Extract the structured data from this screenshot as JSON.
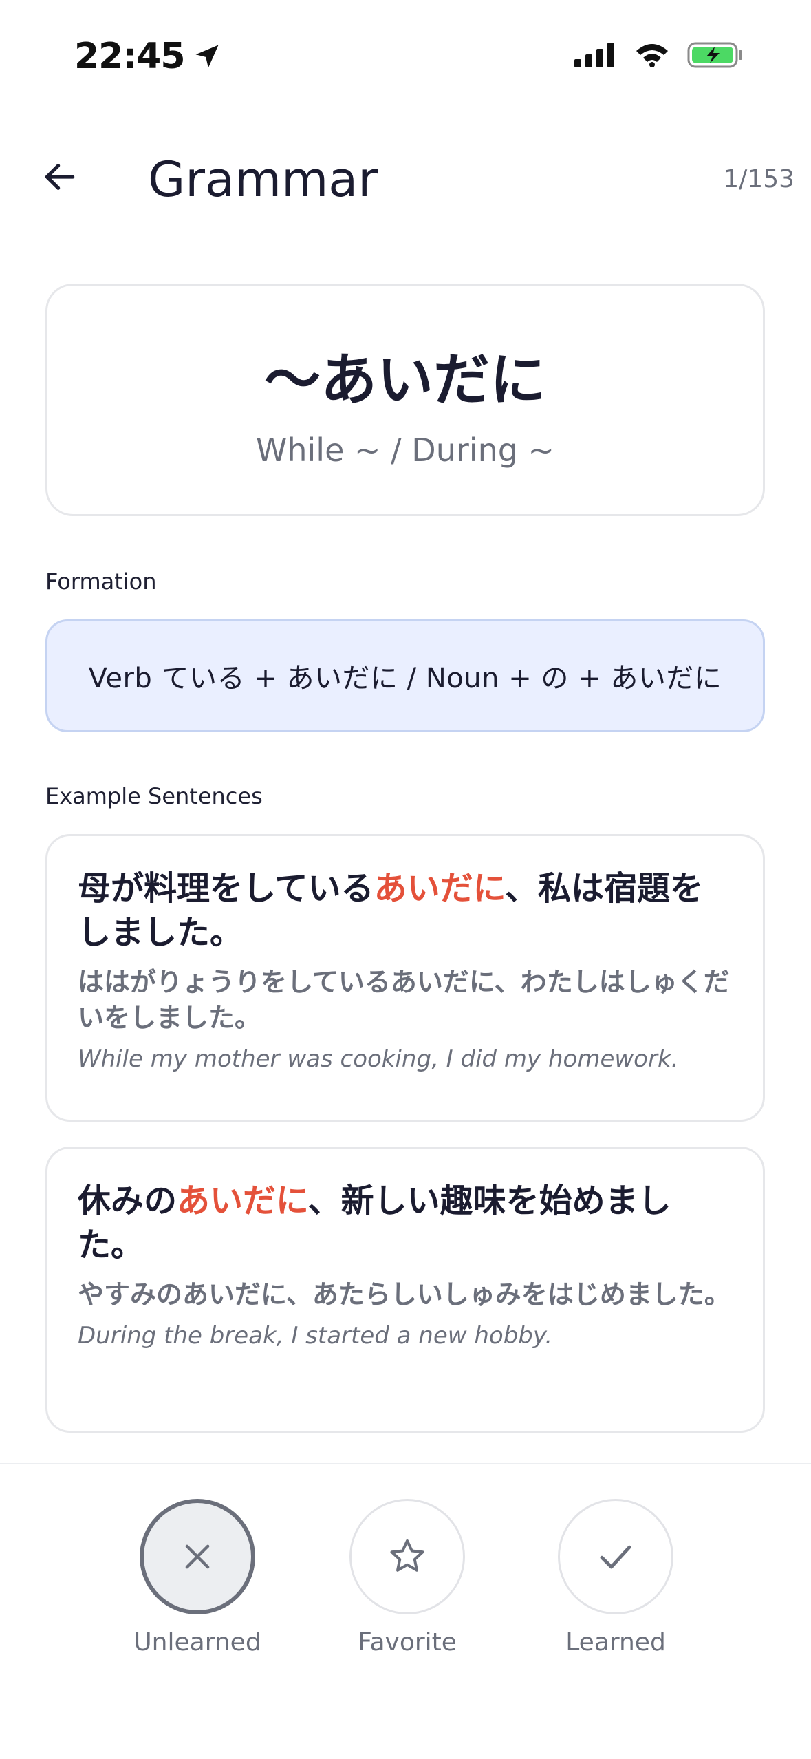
{
  "status_bar": {
    "time": "22:45"
  },
  "header": {
    "title": "Grammar",
    "counter": "1/153"
  },
  "grammar": {
    "pattern": "〜あいだに",
    "meaning": "While ~ / During ~"
  },
  "formation": {
    "label": "Formation",
    "text": "Verb ている + あいだに / Noun + の + あいだに"
  },
  "examples": {
    "label": "Example Sentences",
    "items": [
      {
        "jp_before": "母が料理をしている",
        "jp_highlight": "あいだに",
        "jp_after": "、私は宿題をしました。",
        "kana": "ははがりょうりをしているあいだに、わたしはしゅくだいをしました。",
        "translation": "While my mother was cooking, I did my homework."
      },
      {
        "jp_before": "休みの",
        "jp_highlight": "あいだに",
        "jp_after": "、新しい趣味を始めました。",
        "kana": "やすみのあいだに、あたらしいしゅみをはじめました。",
        "translation": "During the break, I started a new hobby."
      }
    ]
  },
  "actions": {
    "unlearned": "Unlearned",
    "favorite": "Favorite",
    "learned": "Learned"
  },
  "colors": {
    "highlight": "#e4513a",
    "battery": "#4cd964",
    "formation_bg": "#eaefff"
  }
}
